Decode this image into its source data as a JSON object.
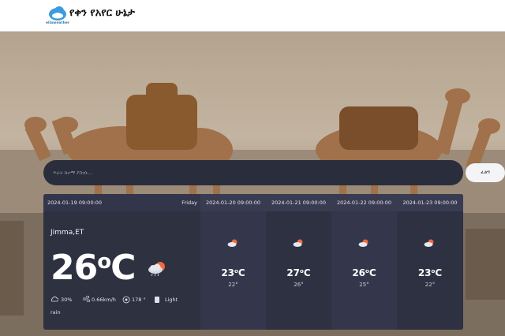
{
  "header": {
    "logo_text": "ellaweather",
    "site_title": "የቀን የአየር ሁኔታ"
  },
  "search": {
    "placeholder": "ጥራት ከተማ ያስገቡ...",
    "button_label": "ፈልግ"
  },
  "current": {
    "datetime": "2024-01-19 09:00:00",
    "day": "Friday",
    "location": "Jimma,ET",
    "temp": "26",
    "unit": "C",
    "cloud": "30%",
    "wind": "0.66km/h",
    "direction": "178 °",
    "condition": "Light",
    "condition2": "rain",
    "icon": "cloud-rain-sun-icon"
  },
  "forecast": [
    {
      "datetime": "2024-01-20 09:00:00",
      "temp": "23",
      "unit": "C",
      "low": "22°",
      "icon": "sun-cloud-icon"
    },
    {
      "datetime": "2024-01-21 09:00:00",
      "temp": "27",
      "unit": "C",
      "low": "26°",
      "icon": "sun-cloud-icon"
    },
    {
      "datetime": "2024-01-22 09:00:00",
      "temp": "26",
      "unit": "C",
      "low": "25°",
      "icon": "sun-cloud-icon"
    },
    {
      "datetime": "2024-01-23 09:00:00",
      "temp": "23",
      "unit": "C",
      "low": "22°",
      "icon": "sun-cloud-icon"
    }
  ],
  "colors": {
    "panel": "#2b2d3c",
    "accent_cloud": "#3b9be0",
    "sun": "#f06a3c"
  }
}
